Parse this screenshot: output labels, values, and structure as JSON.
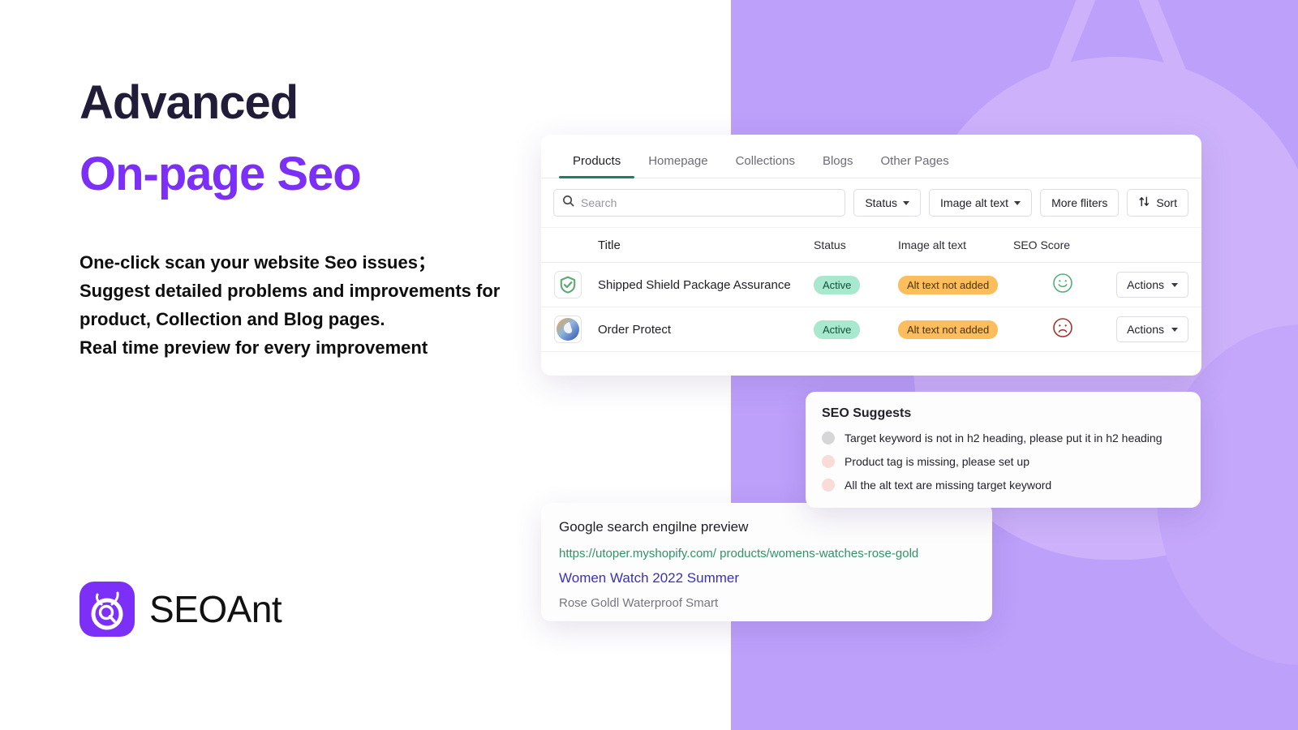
{
  "hero": {
    "title_line1": "Advanced",
    "title_line2": "On-page Seo",
    "subtitle": "One-click scan your website Seo issues；Suggest detailed problems and improvements for product, Collection and Blog pages.\nReal time preview for every improvement"
  },
  "brand": {
    "name": "SEOAnt",
    "logo_icon": "seoant-ant-magnifier-icon",
    "accent_purple": "#7b2ff7",
    "background_purple": "#bca0fa",
    "background_purple_light": "#cdb2fb"
  },
  "product_panel": {
    "tabs": [
      {
        "label": "Products",
        "active": true
      },
      {
        "label": "Homepage",
        "active": false
      },
      {
        "label": "Collections",
        "active": false
      },
      {
        "label": "Blogs",
        "active": false
      },
      {
        "label": "Other Pages",
        "active": false
      }
    ],
    "active_tab_color": "#1c8064",
    "search": {
      "icon": "search-icon",
      "value": "",
      "placeholder": "Search"
    },
    "filters": [
      {
        "label": "Status",
        "caret": true
      },
      {
        "label": "Image alt text",
        "caret": true
      },
      {
        "label": "More fliters",
        "caret": false
      }
    ],
    "sort": {
      "label": "Sort",
      "icon": "sort-arrows-icon"
    },
    "columns": [
      "Title",
      "Status",
      "Image alt text",
      "SEO Score"
    ],
    "rows": [
      {
        "thumb_icon": "green-shield-check-icon",
        "title": "Shipped Shield Package Assurance",
        "status": "Active",
        "alt_text": "Alt text not added",
        "seo_score_icon": "happy-face-icon",
        "seo_score_color": "#4fa878",
        "actions_label": "Actions"
      },
      {
        "thumb_icon": "blue-orange-swirl-icon",
        "title": "Order Protect",
        "status": "Active",
        "alt_text": "Alt text not added",
        "seo_score_icon": "sad-face-icon",
        "seo_score_color": "#a52a2a",
        "actions_label": "Actions"
      }
    ]
  },
  "seo_suggests": {
    "title": "SEO Suggests",
    "items": [
      {
        "text": "Target keyword is not in h2 heading, please put it in h2 heading",
        "dot_color": "#d6d6d9"
      },
      {
        "text": "Product tag is missing, please set up",
        "dot_color": "#f9dbd8"
      },
      {
        "text": "All the alt text are missing target keyword",
        "dot_color": "#f9dbd8"
      }
    ]
  },
  "google_preview": {
    "title": "Google search engilne preview",
    "url": "https://utoper.myshopify.com/ products/womens-watches-rose-gold",
    "link": "Women Watch 2022 Summer",
    "description": "Rose Goldl Waterproof Smart"
  }
}
